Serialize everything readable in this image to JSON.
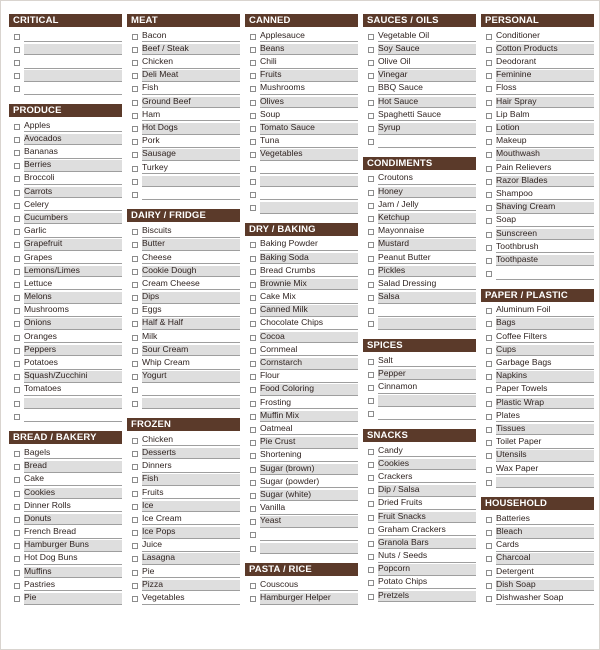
{
  "meta": {
    "title": "Grocery Shopping List",
    "header_bg": "#5b3a2a",
    "header_text": "#ffffff",
    "row_alt_bg": "#dedede",
    "rule_color": "#9e9e9e",
    "checkbox_border": "#8c8c8c"
  },
  "columns": [
    {
      "sections": [
        {
          "title": "CRITICAL",
          "items": [
            "",
            "",
            "",
            "",
            ""
          ]
        },
        {
          "title": "PRODUCE",
          "items": [
            "Apples",
            "Avocados",
            "Bananas",
            "Berries",
            "Broccoli",
            "Carrots",
            "Celery",
            "Cucumbers",
            "Garlic",
            "Grapefruit",
            "Grapes",
            "Lemons/Limes",
            "Lettuce",
            "Melons",
            "Mushrooms",
            "Onions",
            "Oranges",
            "Peppers",
            "Potatoes",
            "Squash/Zucchini",
            "Tomatoes",
            "",
            ""
          ]
        },
        {
          "title": "BREAD / BAKERY",
          "items": [
            "Bagels",
            "Bread",
            "Cake",
            "Cookies",
            "Dinner Rolls",
            "Donuts",
            "French Bread",
            "Hamburger Buns",
            "Hot Dog Buns",
            "Muffins",
            "Pastries",
            "Pie"
          ]
        }
      ]
    },
    {
      "sections": [
        {
          "title": "MEAT",
          "items": [
            "Bacon",
            "Beef / Steak",
            "Chicken",
            "Deli Meat",
            "Fish",
            "Ground Beef",
            "Ham",
            "Hot Dogs",
            "Pork",
            "Sausage",
            "Turkey",
            "",
            ""
          ]
        },
        {
          "title": "DAIRY / FRIDGE",
          "items": [
            "Biscuits",
            "Butter",
            "Cheese",
            "Cookie Dough",
            "Cream Cheese",
            "Dips",
            "Eggs",
            "Half & Half",
            "Milk",
            "Sour Cream",
            "Whip Cream",
            "Yogurt",
            "",
            ""
          ]
        },
        {
          "title": "FROZEN",
          "items": [
            "Chicken",
            "Desserts",
            "Dinners",
            "Fish",
            "Fruits",
            "Ice",
            "Ice Cream",
            "Ice Pops",
            "Juice",
            "Lasagna",
            "Pie",
            "Pizza",
            "Vegetables"
          ]
        }
      ]
    },
    {
      "sections": [
        {
          "title": "CANNED",
          "items": [
            "Applesauce",
            "Beans",
            "Chili",
            "Fruits",
            "Mushrooms",
            "Olives",
            "Soup",
            "Tomato Sauce",
            "Tuna",
            "Vegetables",
            "",
            "",
            "",
            ""
          ]
        },
        {
          "title": "DRY / BAKING",
          "items": [
            "Baking Powder",
            "Baking Soda",
            "Bread Crumbs",
            "Brownie Mix",
            "Cake Mix",
            "Canned Milk",
            "Chocolate Chips",
            "Cocoa",
            "Cornmeal",
            "Cornstarch",
            "Flour",
            "Food Coloring",
            "Frosting",
            "Muffin Mix",
            "Oatmeal",
            "Pie Crust",
            "Shortening",
            "Sugar (brown)",
            "Sugar (powder)",
            "Sugar (white)",
            "Vanilla",
            "Yeast",
            "",
            ""
          ]
        },
        {
          "title": "PASTA / RICE",
          "items": [
            "Couscous",
            "Hamburger Helper"
          ]
        }
      ]
    },
    {
      "sections": [
        {
          "title": "SAUCES / OILS",
          "items": [
            "Vegetable Oil",
            "Soy Sauce",
            "Olive Oil",
            "Vinegar",
            "BBQ Sauce",
            "Hot Sauce",
            "Spaghetti Sauce",
            "Syrup",
            ""
          ]
        },
        {
          "title": "CONDIMENTS",
          "items": [
            "Croutons",
            "Honey",
            "Jam / Jelly",
            "Ketchup",
            "Mayonnaise",
            "Mustard",
            "Peanut Butter",
            "Pickles",
            "Salad Dressing",
            "Salsa",
            "",
            ""
          ]
        },
        {
          "title": "SPICES",
          "items": [
            "Salt",
            "Pepper",
            "Cinnamon",
            "",
            ""
          ]
        },
        {
          "title": "SNACKS",
          "items": [
            "Candy",
            "Cookies",
            "Crackers",
            "Dip / Salsa",
            "Dried Fruits",
            "Fruit Snacks",
            "Graham Crackers",
            "Granola Bars",
            "Nuts / Seeds",
            "Popcorn",
            "Potato Chips",
            "Pretzels"
          ]
        }
      ]
    },
    {
      "sections": [
        {
          "title": "PERSONAL",
          "items": [
            "Conditioner",
            "Cotton Products",
            "Deodorant",
            "Feminine",
            "Floss",
            "Hair Spray",
            "Lip Balm",
            "Lotion",
            "Makeup",
            "Mouthwash",
            "Pain Relievers",
            "Razor Blades",
            "Shampoo",
            "Shaving Cream",
            "Soap",
            "Sunscreen",
            "Toothbrush",
            "Toothpaste",
            ""
          ]
        },
        {
          "title": "PAPER / PLASTIC",
          "items": [
            "Aluminum Foil",
            "Bags",
            "Coffee Filters",
            "Cups",
            "Garbage Bags",
            "Napkins",
            "Paper Towels",
            "Plastic Wrap",
            "Plates",
            "Tissues",
            "Toilet Paper",
            "Utensils",
            "Wax Paper",
            ""
          ]
        },
        {
          "title": "HOUSEHOLD",
          "items": [
            "Batteries",
            "Bleach",
            "Cards",
            "Charcoal",
            "Detergent",
            "Dish Soap",
            "Dishwasher Soap"
          ]
        }
      ]
    }
  ]
}
